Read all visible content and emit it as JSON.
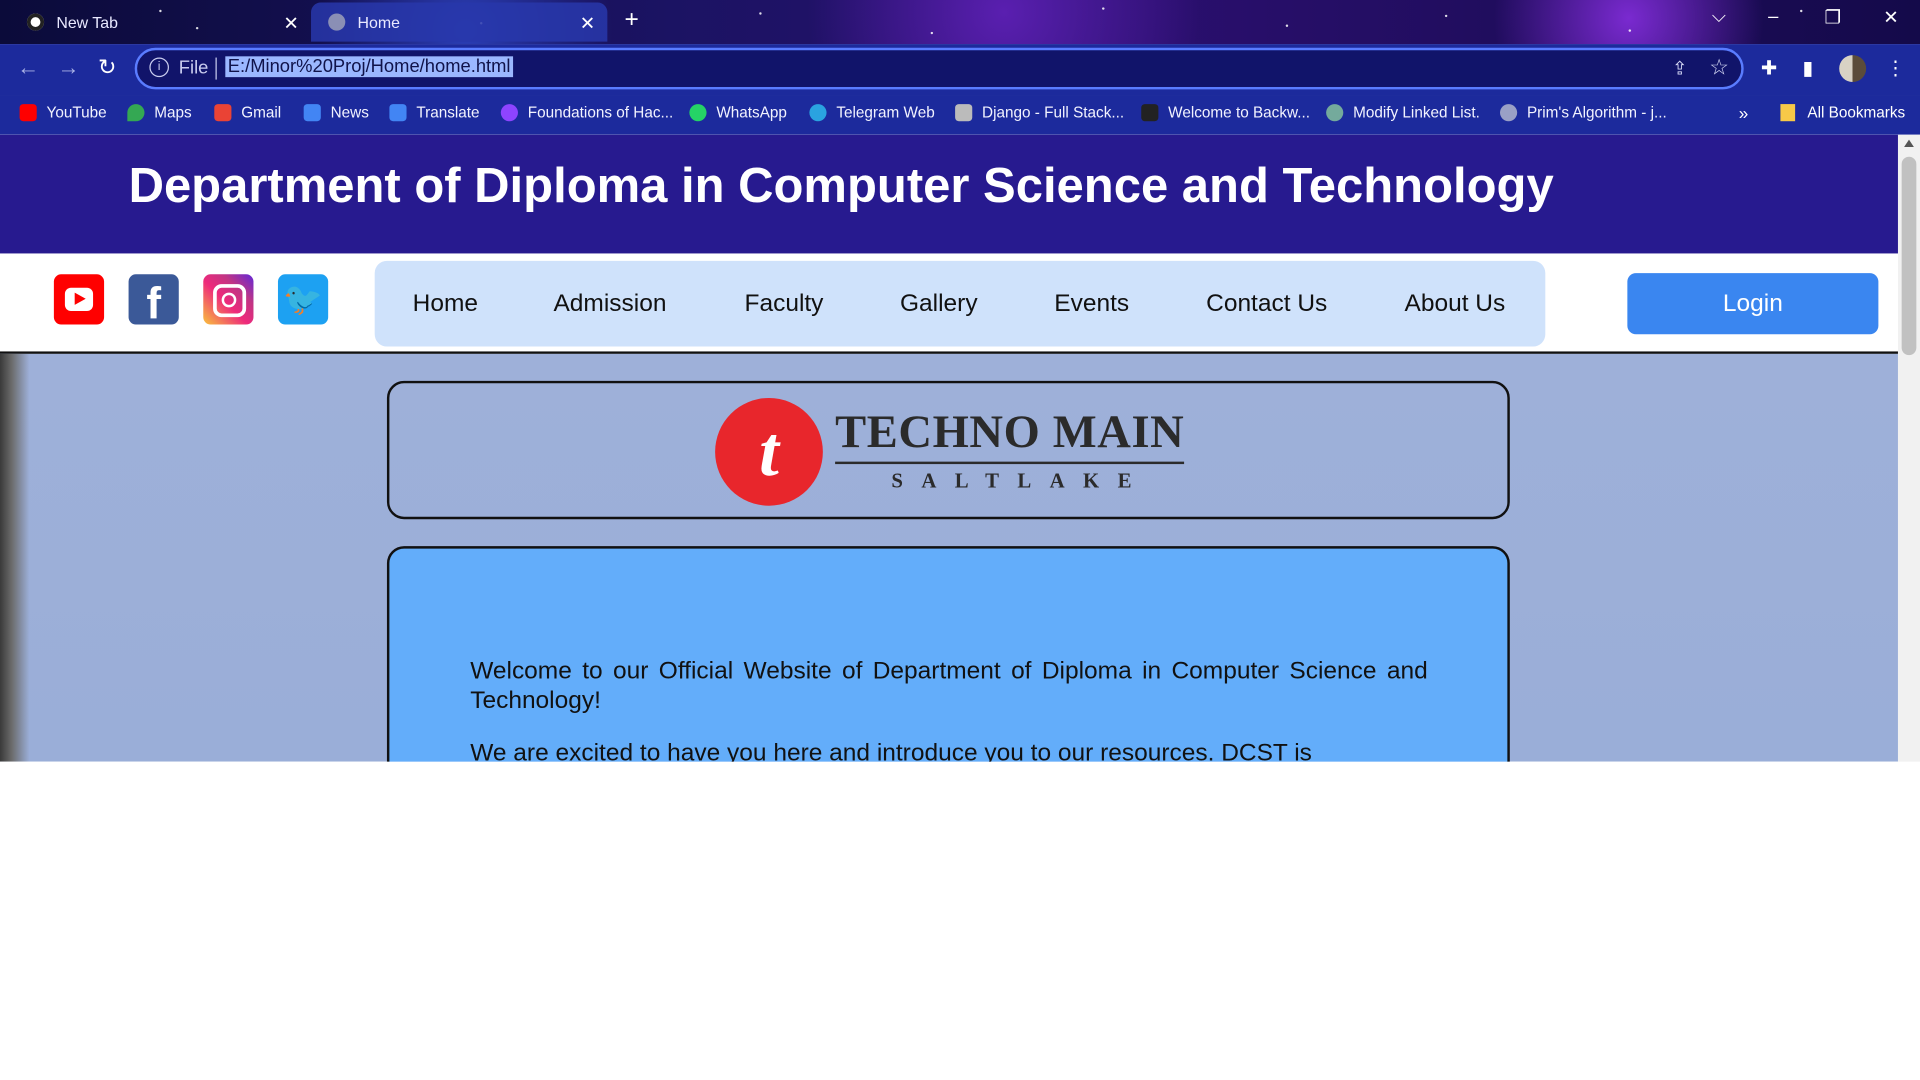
{
  "browser": {
    "tabs": [
      {
        "title": "New Tab",
        "active": false
      },
      {
        "title": "Home",
        "active": true
      }
    ],
    "new_tab_symbol": "+",
    "close_symbol": "✕",
    "window_controls": {
      "dropdown": "⌵",
      "minimize": "–",
      "restore": "❐",
      "close": "✕"
    },
    "address": {
      "scheme_label": "File",
      "url": "E:/Minor%20Proj/Home/home.html"
    },
    "bookmarks": [
      {
        "label": "YouTube",
        "icon": "youtube-icon",
        "color": "#ff0000"
      },
      {
        "label": "Maps",
        "icon": "maps-icon",
        "color": "#34a853"
      },
      {
        "label": "Gmail",
        "icon": "gmail-icon",
        "color": "#ea4335"
      },
      {
        "label": "News",
        "icon": "news-icon",
        "color": "#4285f4"
      },
      {
        "label": "Translate",
        "icon": "translate-icon",
        "color": "#4285f4"
      },
      {
        "label": "Foundations of Hac...",
        "icon": "course-icon",
        "color": "#8e44ff"
      },
      {
        "label": "WhatsApp",
        "icon": "whatsapp-icon",
        "color": "#25d366"
      },
      {
        "label": "Telegram Web",
        "icon": "telegram-icon",
        "color": "#2aa3e0"
      },
      {
        "label": "Django - Full Stack...",
        "icon": "django-icon",
        "color": "#bbbbbb"
      },
      {
        "label": "Welcome to Backw...",
        "icon": "backw-icon",
        "color": "#222222"
      },
      {
        "label": "Modify Linked List.",
        "icon": "chatgpt-icon",
        "color": "#74aa9c"
      },
      {
        "label": "Prim's Algorithm - j...",
        "icon": "globe-icon",
        "color": "#9aa0c6"
      }
    ],
    "more_symbol": "»",
    "all_bookmarks": "All Bookmarks"
  },
  "site": {
    "banner_title": "Department of Diploma in Computer Science and Technology",
    "nav": [
      "Home",
      "Admission",
      "Faculty",
      "Gallery",
      "Events",
      "Contact Us",
      "About Us"
    ],
    "login_label": "Login",
    "social": [
      "youtube-icon",
      "facebook-icon",
      "instagram-icon",
      "twitter-icon"
    ],
    "logo": {
      "mark": "t",
      "name": "TECHNO MAIN",
      "sub": "SALTLAKE"
    },
    "welcome": {
      "p1": "Welcome to our Official Website of Department of Diploma in Computer Science and Technology!",
      "p2": "We are excited to have you here and introduce you to our resources. DCST is"
    }
  },
  "colors": {
    "banner": "#271a8f",
    "menu_bg": "#cfe2fb",
    "login": "#3a86f0",
    "welcome_bg": "#63adfa",
    "logo_red": "#e8262c"
  }
}
